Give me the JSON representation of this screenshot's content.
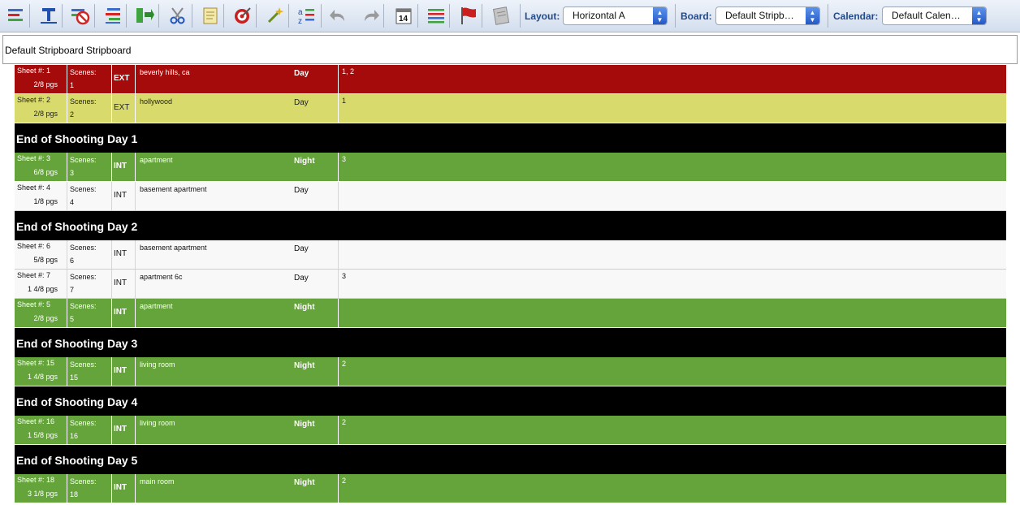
{
  "toolbar": {
    "buttons": [
      {
        "icon": "strip-list-icon"
      },
      {
        "icon": "text-t-icon"
      },
      {
        "icon": "no-entry-icon"
      },
      {
        "icon": "strip-list-alt-icon"
      },
      {
        "icon": "green-arrows-icon"
      },
      {
        "icon": "scissors-icon"
      },
      {
        "icon": "notepad-icon"
      },
      {
        "icon": "target-icon"
      },
      {
        "icon": "magic-wand-icon"
      },
      {
        "icon": "sort-az-icon"
      },
      {
        "icon": "undo-arrow-icon"
      },
      {
        "icon": "redo-arrow-icon"
      },
      {
        "icon": "calendar-14-icon"
      },
      {
        "icon": "stripes-icon"
      },
      {
        "icon": "red-flag-icon"
      },
      {
        "icon": "document-gray-icon"
      }
    ],
    "layout_label": "Layout:",
    "layout_value": "Horizontal A",
    "board_label": "Board:",
    "board_value": "Default Stripb…",
    "calendar_label": "Calendar:",
    "calendar_value": "Default Calen…"
  },
  "board": {
    "title": "Default Stripboard Stripboard",
    "rows": [
      {
        "type": "strip",
        "color": "red",
        "sheet": "Sheet #: 1",
        "pages": "2/8  pgs",
        "scenes_label": "Scenes:",
        "scene": "1",
        "ie": "EXT",
        "location": "beverly hills, ca",
        "daynight": "Day",
        "cast": "1, 2"
      },
      {
        "type": "strip",
        "color": "yellow",
        "sheet": "Sheet #: 2",
        "pages": "2/8  pgs",
        "scenes_label": "Scenes:",
        "scene": "2",
        "ie": "EXT",
        "location": "hollywood",
        "daynight": "Day",
        "cast": "1"
      },
      {
        "type": "dayend",
        "text": "End of Shooting Day 1"
      },
      {
        "type": "strip",
        "color": "green",
        "sheet": "Sheet #: 3",
        "pages": "6/8  pgs",
        "scenes_label": "Scenes:",
        "scene": "3",
        "ie": "INT",
        "location": "apartment",
        "daynight": "Night",
        "cast": "3"
      },
      {
        "type": "strip",
        "color": "white",
        "sheet": "Sheet #: 4",
        "pages": "1/8  pgs",
        "scenes_label": "Scenes:",
        "scene": "4",
        "ie": "INT",
        "location": "basement apartment",
        "daynight": "Day",
        "cast": ""
      },
      {
        "type": "dayend",
        "text": "End of Shooting Day 2"
      },
      {
        "type": "strip",
        "color": "white",
        "sheet": "Sheet #: 6",
        "pages": "5/8  pgs",
        "scenes_label": "Scenes:",
        "scene": "6",
        "ie": "INT",
        "location": "basement apartment",
        "daynight": "Day",
        "cast": ""
      },
      {
        "type": "strip",
        "color": "white",
        "sheet": "Sheet #: 7",
        "pages": "1 4/8  pgs",
        "scenes_label": "Scenes:",
        "scene": "7",
        "ie": "INT",
        "location": "apartment 6c",
        "daynight": "Day",
        "cast": "3"
      },
      {
        "type": "strip",
        "color": "green",
        "sheet": "Sheet #: 5",
        "pages": "2/8  pgs",
        "scenes_label": "Scenes:",
        "scene": "5",
        "ie": "INT",
        "location": "apartment",
        "daynight": "Night",
        "cast": ""
      },
      {
        "type": "dayend",
        "text": "End of Shooting Day 3"
      },
      {
        "type": "strip",
        "color": "green",
        "sheet": "Sheet #: 15",
        "pages": "1 4/8  pgs",
        "scenes_label": "Scenes:",
        "scene": "15",
        "ie": "INT",
        "location": "living room",
        "daynight": "Night",
        "cast": "2"
      },
      {
        "type": "dayend",
        "text": "End of Shooting Day 4"
      },
      {
        "type": "strip",
        "color": "green",
        "sheet": "Sheet #: 16",
        "pages": "1 5/8  pgs",
        "scenes_label": "Scenes:",
        "scene": "16",
        "ie": "INT",
        "location": "living room",
        "daynight": "Night",
        "cast": "2"
      },
      {
        "type": "dayend",
        "text": "End of Shooting Day 5"
      },
      {
        "type": "strip",
        "color": "green",
        "sheet": "Sheet #: 18",
        "pages": "3 1/8  pgs",
        "scenes_label": "Scenes:",
        "scene": "18",
        "ie": "INT",
        "location": "main room",
        "daynight": "Night",
        "cast": "2"
      }
    ]
  }
}
